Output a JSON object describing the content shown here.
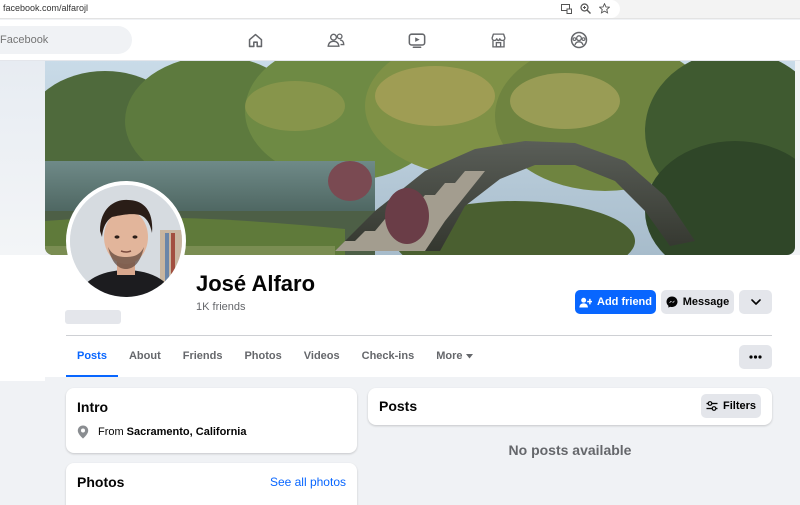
{
  "browser": {
    "url": "facebook.com/alfarojl",
    "icons": [
      "screen-share-icon",
      "zoom-icon",
      "bookmark-star-icon"
    ]
  },
  "topnav": {
    "search_placeholder": "Facebook",
    "icons": [
      "home-icon",
      "friends-icon",
      "watch-icon",
      "marketplace-icon",
      "groups-icon"
    ]
  },
  "profile": {
    "name": "José Alfaro",
    "friends": "1K friends",
    "add_friend_label": "Add friend",
    "message_label": "Message"
  },
  "tabs": [
    {
      "label": "Posts",
      "active": true
    },
    {
      "label": "About",
      "active": false
    },
    {
      "label": "Friends",
      "active": false
    },
    {
      "label": "Photos",
      "active": false
    },
    {
      "label": "Videos",
      "active": false
    },
    {
      "label": "Check-ins",
      "active": false
    },
    {
      "label": "More",
      "active": false
    }
  ],
  "intro": {
    "title": "Intro",
    "from_prefix": "From",
    "from_place": "Sacramento, California"
  },
  "photos": {
    "title": "Photos",
    "see_all": "See all photos"
  },
  "posts": {
    "title": "Posts",
    "filters_label": "Filters",
    "empty_message": "No posts available"
  },
  "colors": {
    "accent": "#0866ff",
    "secondary_button": "#e4e6eb",
    "muted_text": "#65676b",
    "page_background": "#f0f2f5"
  }
}
